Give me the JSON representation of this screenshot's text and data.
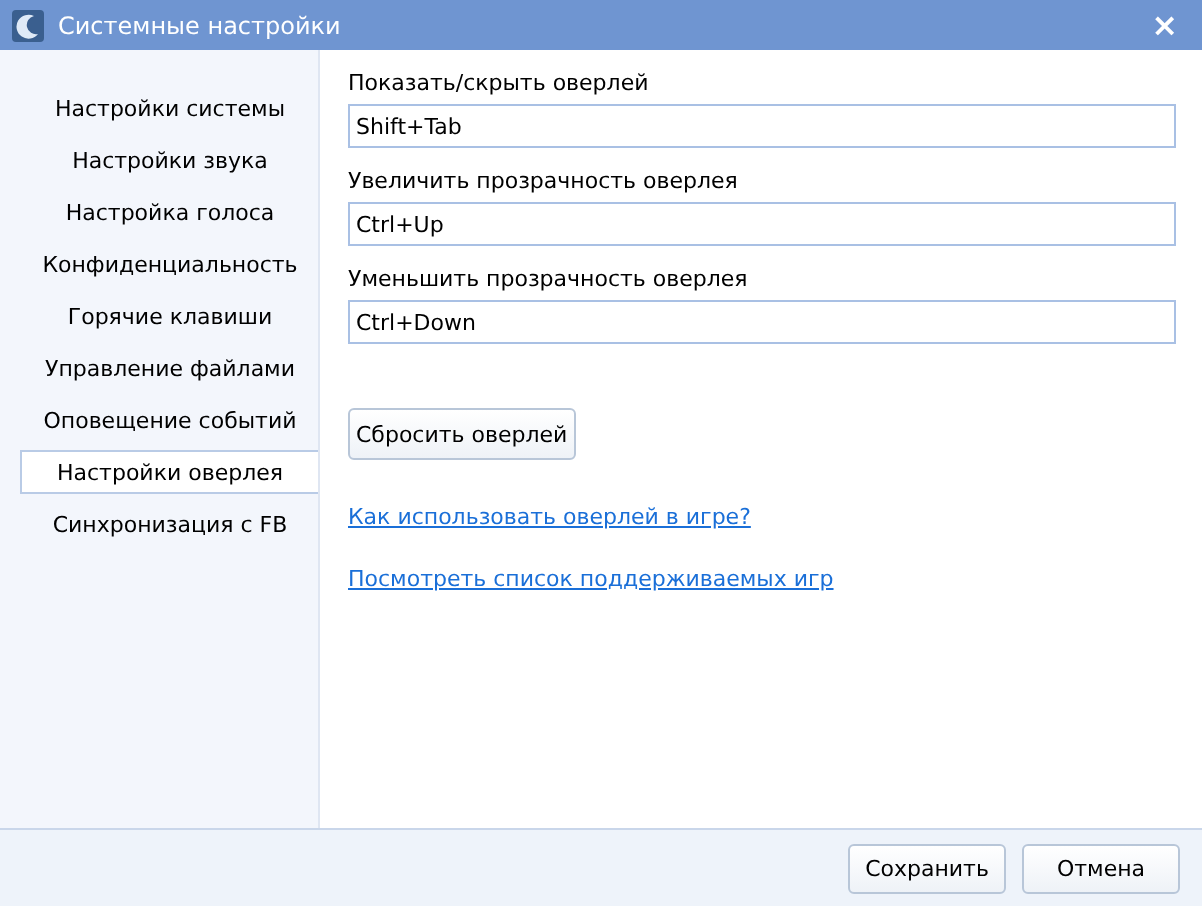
{
  "window": {
    "title": "Системные настройки",
    "close": "×"
  },
  "sidebar": {
    "items": [
      {
        "label": "Настройки системы",
        "selected": false
      },
      {
        "label": "Настройки звука",
        "selected": false
      },
      {
        "label": "Настройка голоса",
        "selected": false
      },
      {
        "label": "Конфиденциальность",
        "selected": false
      },
      {
        "label": "Горячие клавиши",
        "selected": false
      },
      {
        "label": "Управление файлами",
        "selected": false
      },
      {
        "label": "Оповещение событий",
        "selected": false
      },
      {
        "label": "Настройки оверлея",
        "selected": true
      },
      {
        "label": "Синхронизация с FB",
        "selected": false
      }
    ]
  },
  "fields": [
    {
      "label": "Показать/скрыть оверлей",
      "value": "Shift+Tab"
    },
    {
      "label": "Увеличить прозрачность оверлея",
      "value": "Ctrl+Up"
    },
    {
      "label": "Уменьшить прозрачность оверлея",
      "value": "Ctrl+Down"
    }
  ],
  "reset_button": "Сбросить оверлей",
  "links": [
    "Как использовать оверлей в игре?",
    "Посмотреть список поддерживаемых игр"
  ],
  "buttons": [
    "Сохранить",
    "Отмена"
  ]
}
